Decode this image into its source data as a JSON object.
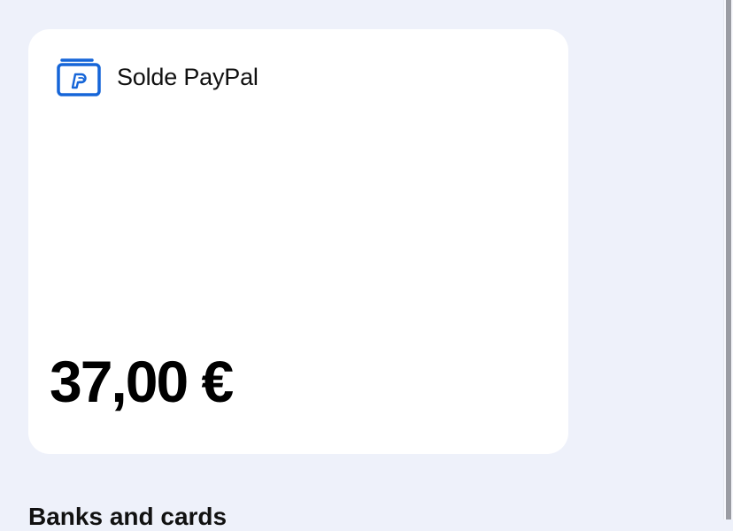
{
  "colors": {
    "page_background": "#eef1fa",
    "card_background": "#ffffff",
    "accent": "#1565d8"
  },
  "balance_card": {
    "icon": "paypal-wallet-icon",
    "title": "Solde PayPal",
    "amount": "37,00 €"
  },
  "next_section": {
    "heading": "Banks and cards"
  }
}
